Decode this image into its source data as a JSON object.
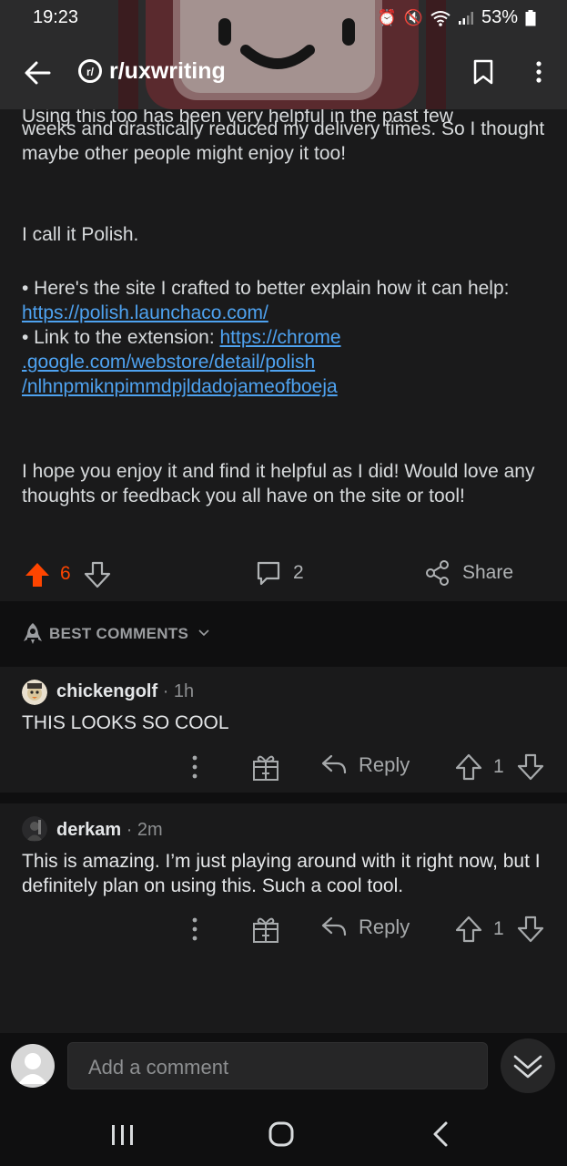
{
  "status_bar": {
    "time": "19:23",
    "battery": "53%"
  },
  "toolbar": {
    "subreddit": "r/uxwriting"
  },
  "post": {
    "partial_line": "Using this too has been very helpful in the past few",
    "paragraph1": "weeks and drastically reduced my delivery times. So I thought maybe other people might enjoy it too!",
    "paragraph2": "I call it Polish.",
    "bullet1_text": "• Here's the site I crafted to better explain how it can help: ",
    "bullet1_link": "https://polish.launchaco.com/",
    "bullet2_text": "• Link to the extension: ",
    "bullet2_link": "https://chrome.google.com/webstore/detail/polish/nlhnpmiknpimmdpjldadojameofboeja",
    "bullet2_link_line1": "https://chrome",
    "bullet2_link_line2": ".google.com/webstore/detail/polish",
    "bullet2_link_line3": "/nlhnpmiknpimmdpjldadojameofboeja",
    "paragraph3": "I hope you enjoy it and find it helpful as I did! Would love any thoughts or feedback you all have on the site or tool!",
    "vote_count": "6",
    "comment_count": "2",
    "share_label": "Share"
  },
  "comments_header": {
    "sort_label": "BEST COMMENTS"
  },
  "comments": [
    {
      "author": "chickengolf",
      "time": " · 1h",
      "body": "THIS LOOKS SO COOL",
      "reply_label": "Reply",
      "score": "1"
    },
    {
      "author": "derkam",
      "time": " · 2m",
      "body": "This is amazing. I’m just playing around with it right now, but I definitely plan on using this. Such a cool tool.",
      "reply_label": "Reply",
      "score": "1"
    }
  ],
  "comment_input": {
    "placeholder": "Add a comment"
  },
  "colors": {
    "background": "#1a1a1b",
    "upvote": "#ff4500",
    "link": "#4ea2f0"
  }
}
